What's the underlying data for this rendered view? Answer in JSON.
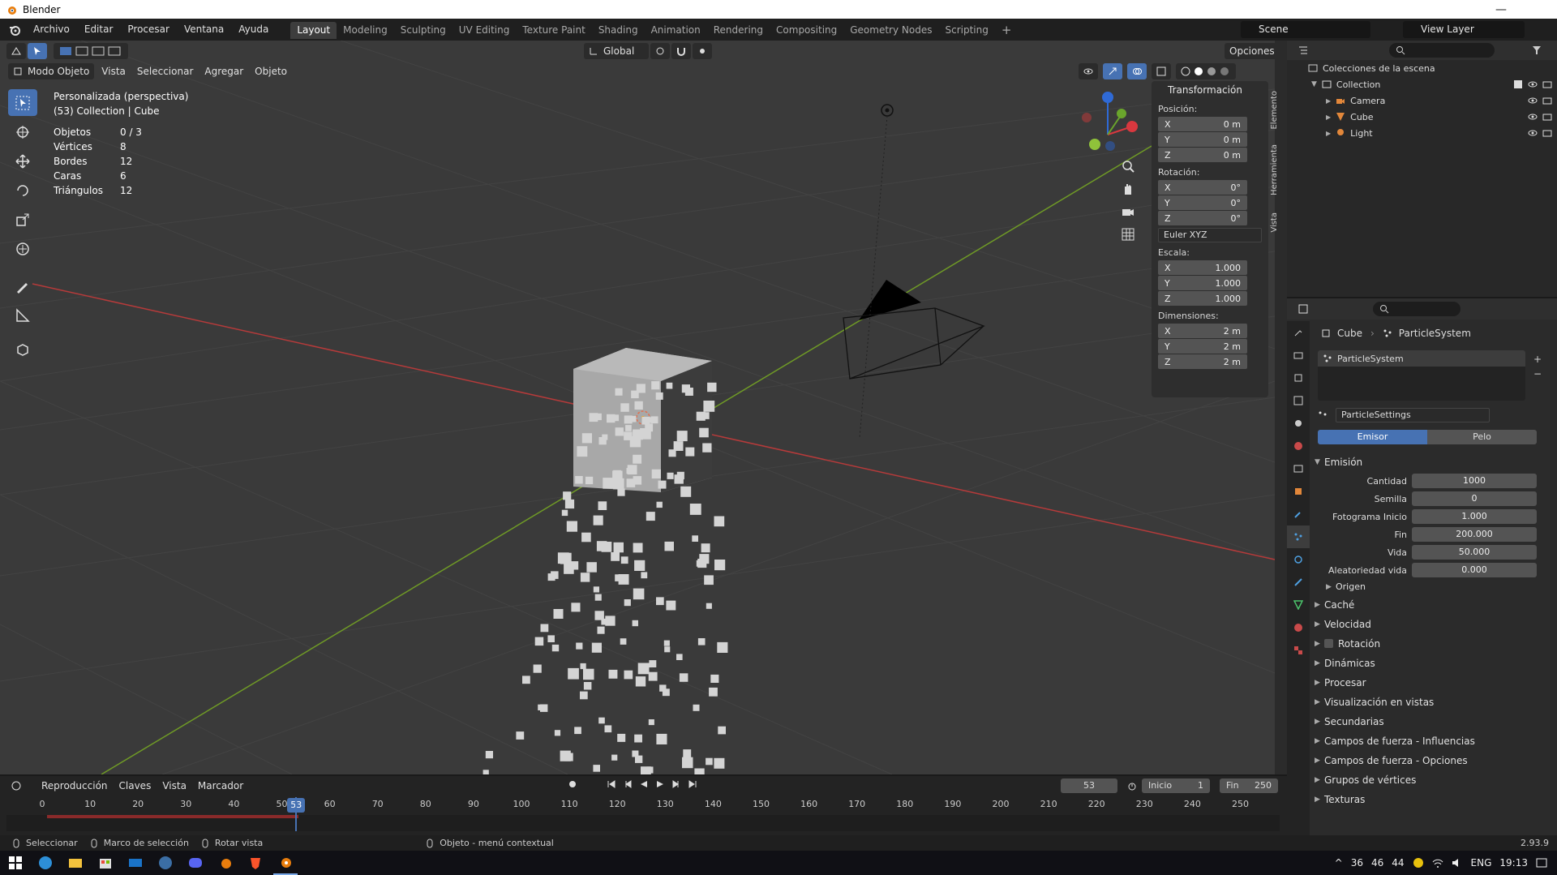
{
  "window": {
    "title": "Blender"
  },
  "menu": [
    "Archivo",
    "Editar",
    "Procesar",
    "Ventana",
    "Ayuda"
  ],
  "workspaces": [
    "Layout",
    "Modeling",
    "Sculpting",
    "UV Editing",
    "Texture Paint",
    "Shading",
    "Animation",
    "Rendering",
    "Compositing",
    "Geometry Nodes",
    "Scripting"
  ],
  "active_workspace": "Layout",
  "scene": {
    "scene_name": "Scene",
    "view_layer": "View Layer"
  },
  "viewport": {
    "mode": "Modo Objeto",
    "menus": [
      "Vista",
      "Seleccionar",
      "Agregar",
      "Objeto"
    ],
    "transform_orientation": "Global",
    "options_label": "Opciones",
    "view_name": "Personalizada (perspectiva)",
    "collection_info": "(53) Collection | Cube",
    "stats": [
      {
        "k": "Objetos",
        "v": "0 / 3"
      },
      {
        "k": "Vértices",
        "v": "8"
      },
      {
        "k": "Bordes",
        "v": "12"
      },
      {
        "k": "Caras",
        "v": "6"
      },
      {
        "k": "Triángulos",
        "v": "12"
      }
    ]
  },
  "npanel": {
    "title": "Transformación",
    "position_label": "Posición:",
    "position": {
      "x": "0 m",
      "y": "0 m",
      "z": "0 m"
    },
    "rotation_label": "Rotación:",
    "rotation": {
      "x": "0°",
      "y": "0°",
      "z": "0°"
    },
    "rotation_mode": "Euler XYZ",
    "scale_label": "Escala:",
    "scale": {
      "x": "1.000",
      "y": "1.000",
      "z": "1.000"
    },
    "dimensions_label": "Dimensiones:",
    "dimensions": {
      "x": "2 m",
      "y": "2 m",
      "z": "2 m"
    },
    "axis_x": "X",
    "axis_y": "Y",
    "axis_z": "Z",
    "tabs": [
      "Elemento",
      "Herramienta",
      "Vista"
    ]
  },
  "outliner": {
    "root": "Colecciones de la escena",
    "collection": "Collection",
    "items": [
      "Camera",
      "Cube",
      "Light"
    ]
  },
  "properties": {
    "breadcrumb_object": "Cube",
    "breadcrumb_system": "ParticleSystem",
    "particle_system": "ParticleSystem",
    "particle_settings": "ParticleSettings",
    "type_emitter": "Emisor",
    "type_hair": "Pelo",
    "emission_title": "Emisión",
    "fields": [
      {
        "label": "Cantidad",
        "value": "1000"
      },
      {
        "label": "Semilla",
        "value": "0"
      },
      {
        "label": "Fotograma Inicio",
        "value": "1.000"
      },
      {
        "label": "Fin",
        "value": "200.000"
      },
      {
        "label": "Vida",
        "value": "50.000"
      },
      {
        "label": "Aleatoriedad vida",
        "value": "0.000"
      }
    ],
    "origin_label": "Origen",
    "sections": [
      "Caché",
      "Velocidad",
      "Rotación",
      "Dinámicas",
      "Procesar",
      "Visualización en vistas",
      "Secundarias",
      "Campos de fuerza - Influencias",
      "Campos de fuerza - Opciones",
      "Grupos de vértices",
      "Texturas"
    ]
  },
  "timeline": {
    "menus": [
      "Reproducción",
      "Claves",
      "Vista",
      "Marcador"
    ],
    "current_frame": "53",
    "start_label": "Inicio",
    "start": "1",
    "end_label": "Fin",
    "end": "250",
    "ticks": [
      "0",
      "10",
      "20",
      "30",
      "40",
      "50",
      "60",
      "70",
      "80",
      "90",
      "100",
      "110",
      "120",
      "130",
      "140",
      "150",
      "160",
      "170",
      "180",
      "190",
      "200",
      "210",
      "220",
      "230",
      "240",
      "250"
    ]
  },
  "statusbar": {
    "items": [
      "Seleccionar",
      "Marco de selección",
      "Rotar vista",
      "Objeto - menú contextual"
    ],
    "version": "2.93.9"
  },
  "taskbar": {
    "tray_nums": [
      "36",
      "46",
      "44"
    ],
    "lang": "ENG",
    "time": "19:13"
  },
  "colors": {
    "accent": "#4772b3",
    "x_axis": "#b63a3a",
    "y_axis": "#6f9a26",
    "bg": "#3a3a3a"
  }
}
